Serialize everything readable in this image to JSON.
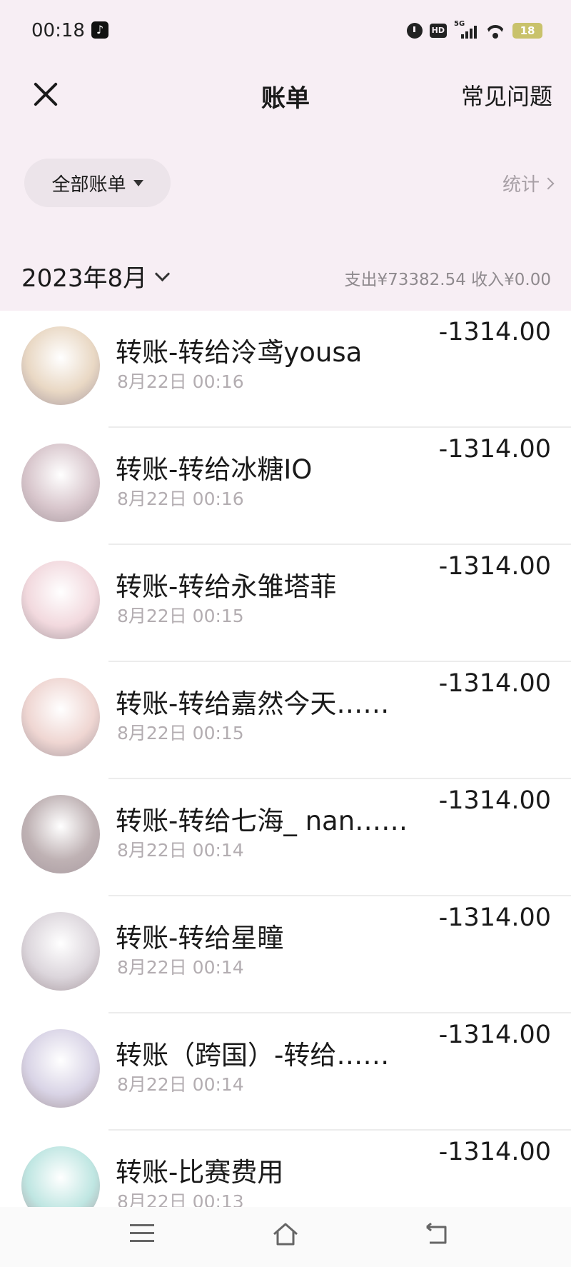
{
  "status_bar": {
    "time": "00:18",
    "battery": "18"
  },
  "header": {
    "title": "账单",
    "faq_label": "常见问题"
  },
  "filter": {
    "all_bills_label": "全部账单",
    "stats_label": "统计"
  },
  "month": {
    "label": "2023年8月",
    "summary": "支出¥73382.54 收入¥0.00"
  },
  "transactions": [
    {
      "title": "转账-转给泠鸢yousa",
      "time": "8月22日 00:16",
      "amount": "-1314.00",
      "avatar_color": "#e9d8c4"
    },
    {
      "title": " 转账-转给冰糖IO",
      "time": "8月22日 00:16",
      "amount": "-1314.00",
      "avatar_color": "#d8c6cc"
    },
    {
      "title": "转账-转给永雏塔菲",
      "time": "8月22日 00:15",
      "amount": "-1314.00",
      "avatar_color": "#f2d9de"
    },
    {
      "title": "转账-转给嘉然今天……",
      "time": "8月22日 00:15",
      "amount": "-1314.00",
      "avatar_color": "#efd6d2"
    },
    {
      "title": "转账-转给七海_ nan……",
      "time": "8月22日 00:14",
      "amount": "-1314.00",
      "avatar_color": "#bfb2b4"
    },
    {
      "title": "转账-转给星瞳",
      "time": "8月22日 00:14",
      "amount": "-1314.00",
      "avatar_color": "#dcd6dc"
    },
    {
      "title": "转账（跨国）-转给……",
      "time": "8月22日 00:14",
      "amount": "-1314.00",
      "avatar_color": "#d9d4e6"
    },
    {
      "title": "转账-比赛费用",
      "time": "8月22日 00:13",
      "amount": "-1314.00",
      "avatar_color": "#bfe6e2"
    }
  ],
  "icons": {
    "close": "close-icon",
    "dropdown": "triangle-down-icon",
    "chevron": "chevron-right-icon",
    "month_chevron": "chevron-down-icon",
    "nav_menu": "menu-icon",
    "nav_home": "home-icon",
    "nav_back": "back-icon"
  }
}
